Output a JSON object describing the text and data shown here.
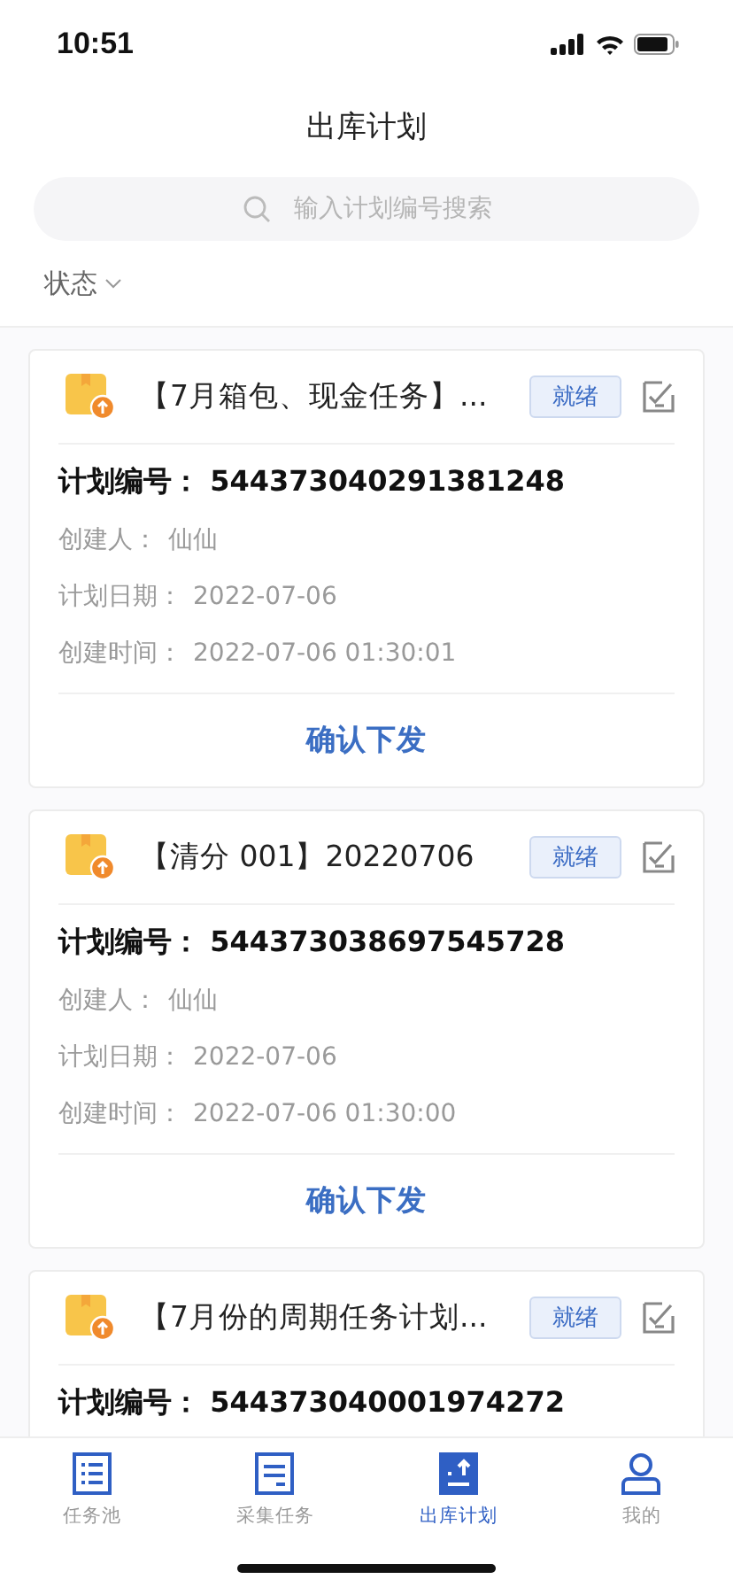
{
  "status_bar": {
    "time": "10:51"
  },
  "header": {
    "title": "出库计划"
  },
  "search": {
    "placeholder": "输入计划编号搜索"
  },
  "filter": {
    "label": "状态"
  },
  "plans": [
    {
      "title": "【7月箱包、现金任务】...",
      "status": "就绪",
      "plan_no_label": "计划编号：",
      "plan_no": "544373040291381248",
      "details": [
        {
          "label": "创建人：",
          "value": "仙仙"
        },
        {
          "label": "计划日期：",
          "value": "2022-07-06"
        },
        {
          "label": "创建时间：",
          "value": "2022-07-06 01:30:01"
        }
      ],
      "action": "确认下发"
    },
    {
      "title": "【清分 001】20220706",
      "status": "就绪",
      "plan_no_label": "计划编号：",
      "plan_no": "544373038697545728",
      "details": [
        {
          "label": "创建人：",
          "value": "仙仙"
        },
        {
          "label": "计划日期：",
          "value": "2022-07-06"
        },
        {
          "label": "创建时间：",
          "value": "2022-07-06 01:30:00"
        }
      ],
      "action": "确认下发"
    },
    {
      "title": "【7月份的周期任务计划...",
      "status": "就绪",
      "plan_no_label": "计划编号：",
      "plan_no": "544373040001974272"
    }
  ],
  "tabs": [
    {
      "label": "任务池",
      "kind": "list",
      "selected": false
    },
    {
      "label": "采集任务",
      "kind": "doc",
      "selected": false
    },
    {
      "label": "出库计划",
      "kind": "upload",
      "selected": true
    },
    {
      "label": "我的",
      "kind": "person",
      "selected": false
    }
  ]
}
